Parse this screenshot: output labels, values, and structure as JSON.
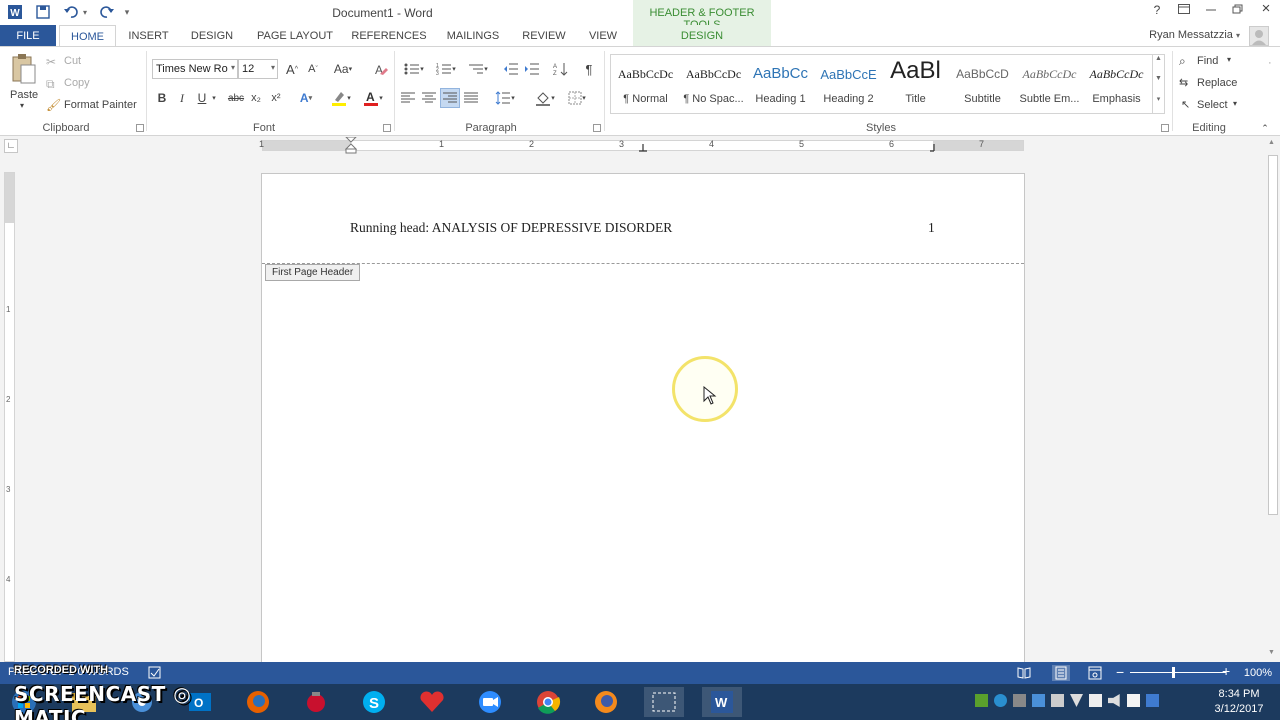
{
  "app": {
    "window_title": "Document1 - Word",
    "contextual_group": "HEADER & FOOTER TOOLS",
    "user_name": "Ryan Messatzzia",
    "help": "?",
    "close_label": "×"
  },
  "tabs": {
    "file": "FILE",
    "home": "HOME",
    "insert": "INSERT",
    "design": "DESIGN",
    "page_layout": "PAGE LAYOUT",
    "references": "REFERENCES",
    "mailings": "MAILINGS",
    "review": "REVIEW",
    "view": "VIEW",
    "hf_design": "DESIGN"
  },
  "clipboard": {
    "paste": "Paste",
    "cut": "Cut",
    "copy": "Copy",
    "format_painter": "Format Painter",
    "label": "Clipboard"
  },
  "font": {
    "family": "Times New Ro",
    "size": "12",
    "label": "Font",
    "bold": "B",
    "italic": "I",
    "underline": "U",
    "strike": "abc",
    "subscript": "x₂",
    "superscript": "x²",
    "grow": "A",
    "shrink": "A",
    "change_case": "Aa",
    "text_effects": "A",
    "font_color": "A"
  },
  "paragraph": {
    "label": "Paragraph",
    "show_marks": "¶"
  },
  "styles": {
    "label": "Styles",
    "items": [
      {
        "sample": "AaBbCcDc",
        "name": "¶ Normal",
        "color": "#222222"
      },
      {
        "sample": "AaBbCcDc",
        "name": "¶ No Spac...",
        "color": "#222222"
      },
      {
        "sample": "AaBbCc",
        "name": "Heading 1",
        "color": "#2e74b5"
      },
      {
        "sample": "AaBbCcE",
        "name": "Heading 2",
        "color": "#2e74b5"
      },
      {
        "sample": "AaBl",
        "name": "Title",
        "color": "#222222"
      },
      {
        "sample": "AaBbCcD",
        "name": "Subtitle",
        "color": "#666666"
      },
      {
        "sample": "AaBbCcDc",
        "name": "Subtle Em...",
        "color": "#666666"
      },
      {
        "sample": "AaBbCcDc",
        "name": "Emphasis",
        "color": "#222222"
      }
    ]
  },
  "editing": {
    "label": "Editing",
    "find": "Find",
    "replace": "Replace",
    "select": "Select"
  },
  "ruler": {
    "numbers": [
      "1",
      "1",
      "2",
      "3",
      "4",
      "5",
      "6",
      "7"
    ],
    "vertical_numbers": [
      "1",
      "2",
      "3",
      "4"
    ]
  },
  "document": {
    "header_text": "Running head: ANALYSIS OF DEPRESSIVE DISORDER",
    "page_number": "1",
    "header_tag": "First Page Header"
  },
  "status": {
    "words": "PAGE 1 OF 1   0 WORDS",
    "zoom": "100%"
  },
  "watermark": {
    "recorded": "RECORDED WITH",
    "brand": "SCREENCAST ◎ MATIC"
  },
  "clock": {
    "time": "8:34 PM",
    "date": "3/12/2017"
  },
  "colors": {
    "file_tab": "#2b579a",
    "contextual": "#3a8d33",
    "statusbar": "#2b579a",
    "taskbar": "#1c3a5e",
    "highlight": "#f3e36a"
  }
}
